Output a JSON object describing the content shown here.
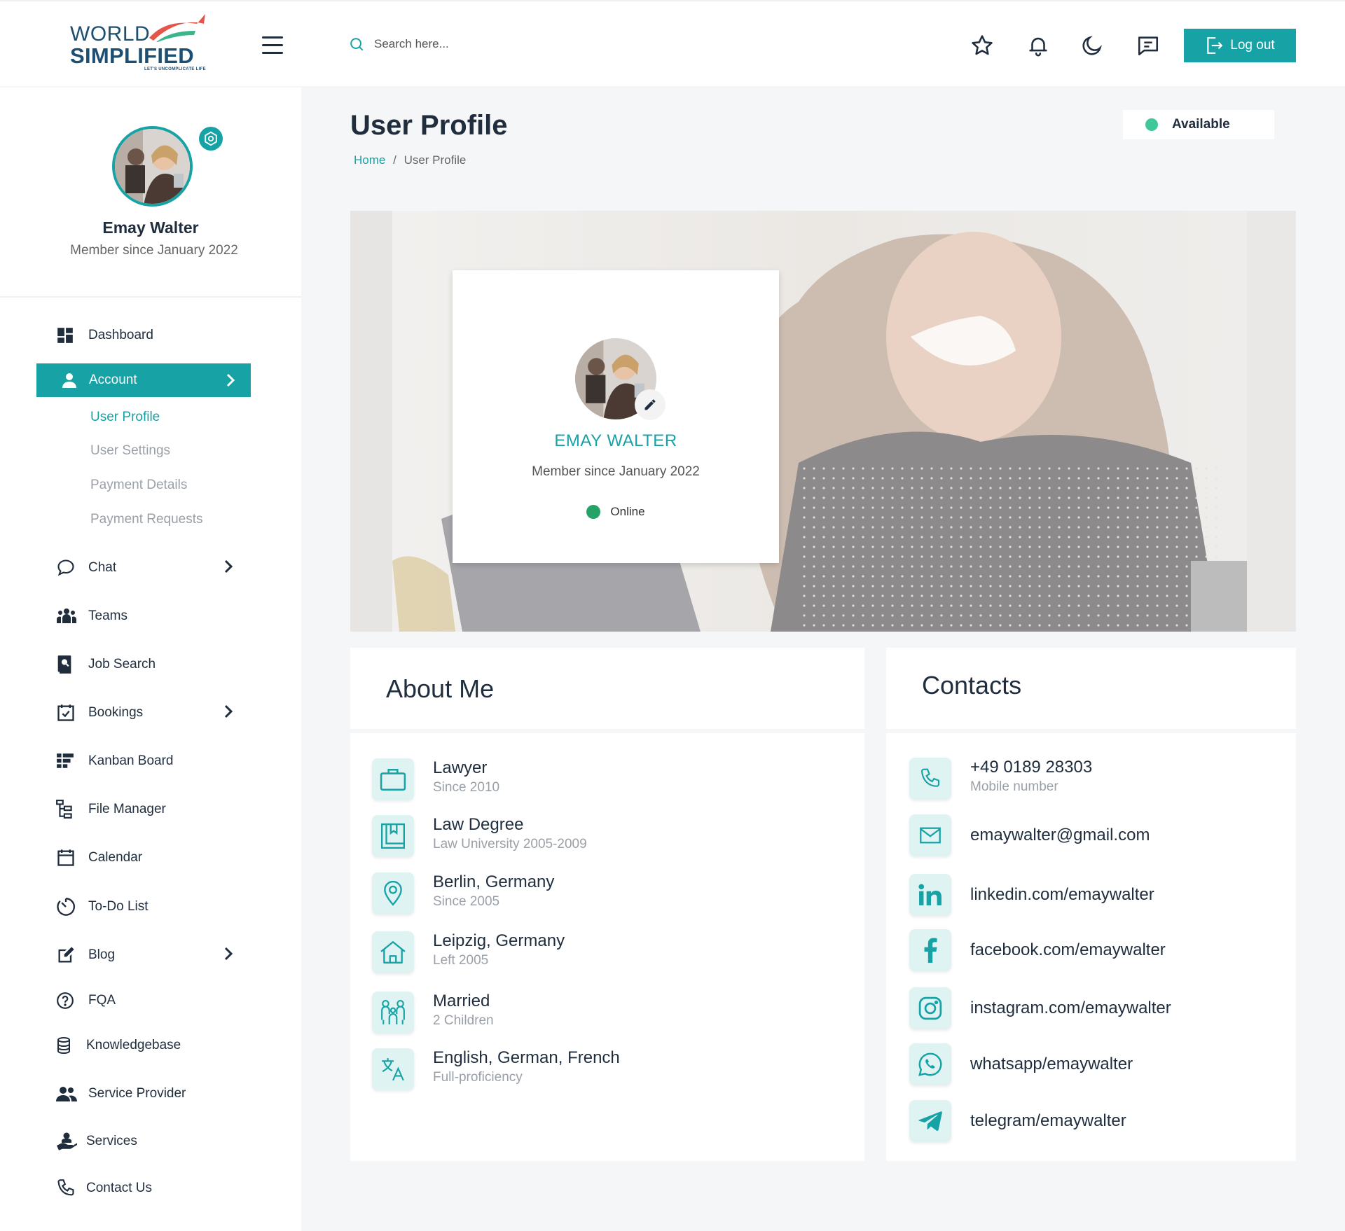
{
  "brand": {
    "line1": "WORLD",
    "line2": "SIMPLIFIED",
    "tagline": "LET'S UNCOMPLICATE LIFE"
  },
  "header": {
    "search_placeholder": "Search here...",
    "logout_label": "Log out",
    "icons": [
      "hamburger-icon",
      "search-icon",
      "star-icon",
      "bell-icon",
      "moon-icon",
      "chat-icon",
      "logout-icon"
    ]
  },
  "sidebar": {
    "user_name": "Emay Walter",
    "member_since": "Member since January 2022",
    "nav": {
      "dashboard": "Dashboard",
      "account": "Account",
      "user_profile": "User Profile",
      "user_settings": "User Settings",
      "payment_details": "Payment Details",
      "payment_requests": "Payment Requests",
      "chat": "Chat",
      "teams": "Teams",
      "job_search": "Job Search",
      "bookings": "Bookings",
      "kanban_board": "Kanban Board",
      "file_manager": "File Manager",
      "calendar": "Calendar",
      "todo_list": "To-Do List",
      "blog": "Blog",
      "fqa": "FQA",
      "knowledgebase": "Knowledgebase",
      "service_provider": "Service Provider",
      "services": "Services",
      "contact_us": "Contact Us"
    }
  },
  "page": {
    "title": "User Profile",
    "breadcrumb_home": "Home",
    "breadcrumb_sep": "/",
    "breadcrumb_current": "User Profile",
    "availability": "Available"
  },
  "profile_card": {
    "name": "EMAY WALTER",
    "member_since": "Member since January 2022",
    "status": "Online"
  },
  "about": {
    "title": "About Me",
    "items": [
      {
        "main": "Lawyer",
        "sub": "Since 2010",
        "icon": "briefcase-icon"
      },
      {
        "main": "Law Degree",
        "sub": "Law University 2005-2009",
        "icon": "book-icon"
      },
      {
        "main": "Berlin, Germany",
        "sub": "Since 2005",
        "icon": "location-pin-icon"
      },
      {
        "main": "Leipzig, Germany",
        "sub": "Left 2005",
        "icon": "home-icon"
      },
      {
        "main": "Married",
        "sub": "2 Children",
        "icon": "family-icon"
      },
      {
        "main": "English, German, French",
        "sub": "Full-proficiency",
        "icon": "translate-icon"
      }
    ]
  },
  "contacts": {
    "title": "Contacts",
    "phone": "+49 0189 28303",
    "phone_sub": "Mobile number",
    "email": "emaywalter@gmail.com",
    "linkedin": "linkedin.com/emaywalter",
    "facebook": "facebook.com/emaywalter",
    "instagram": "instagram.com/emaywalter",
    "whatsapp": "whatsapp/emaywalter",
    "telegram": "telegram/emaywalter"
  },
  "colors": {
    "accent": "#17a2a6",
    "dark_text": "#1f2d3d",
    "muted_text": "#9aa0a8",
    "online_green": "#25a268",
    "available_green": "#3fc79a",
    "icon_bg": "#dff3f3",
    "logo_red": "#e4554a"
  }
}
